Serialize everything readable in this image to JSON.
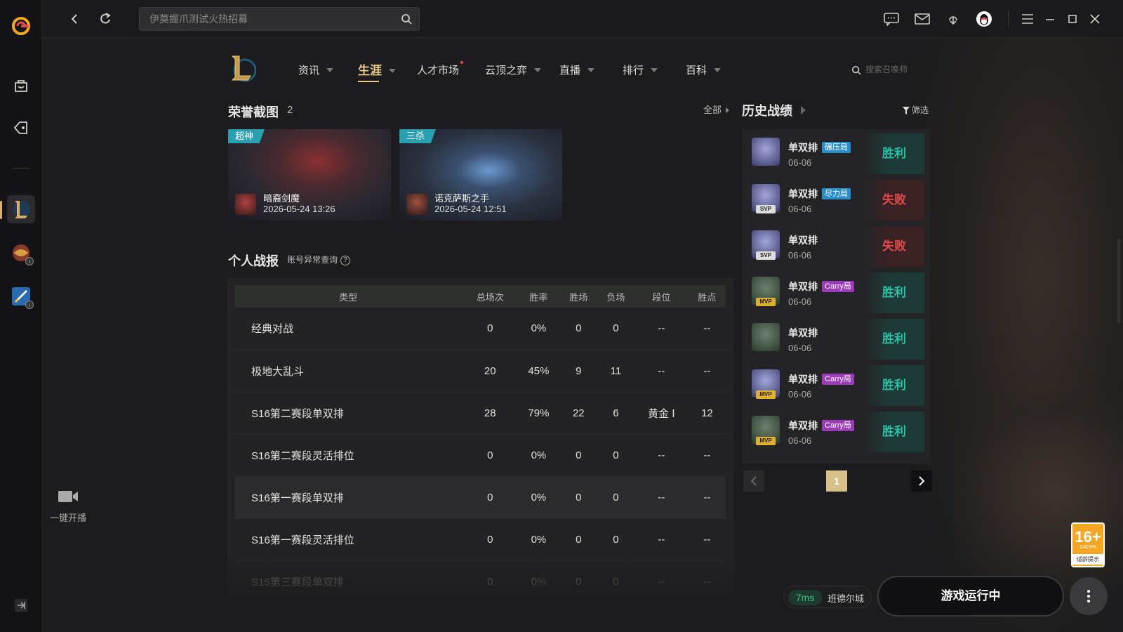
{
  "topbar": {
    "search_placeholder": "伊莫握爪测试火热招募"
  },
  "sidebar": {
    "live_label": "一键开播"
  },
  "nav": {
    "items": [
      {
        "label": "资讯"
      },
      {
        "label": "生涯"
      },
      {
        "label": "人才市场"
      },
      {
        "label": "云顶之弈"
      },
      {
        "label": "直播"
      },
      {
        "label": "排行"
      },
      {
        "label": "百科"
      }
    ],
    "summoner_search": "搜索召唤师"
  },
  "honor": {
    "title": "荣誉截图",
    "count": "2",
    "all_link": "全部",
    "shots": [
      {
        "tag": "超神",
        "champion": "暗裔剑魔",
        "time": "2026-05-24 13:26"
      },
      {
        "tag": "三杀",
        "champion": "诺克萨斯之手",
        "time": "2026-05-24 12:51"
      }
    ]
  },
  "stats": {
    "title": "个人战报",
    "sub_link": "账号异常查询",
    "help": "?",
    "headers": [
      "类型",
      "总场次",
      "胜率",
      "胜场",
      "负场",
      "段位",
      "胜点"
    ],
    "rows": [
      [
        "经典对战",
        "0",
        "0%",
        "0",
        "0",
        "--",
        "--"
      ],
      [
        "极地大乱斗",
        "20",
        "45%",
        "9",
        "11",
        "--",
        "--"
      ],
      [
        "S16第二赛段单双排",
        "28",
        "79%",
        "22",
        "6",
        "黄金 Ⅰ",
        "12"
      ],
      [
        "S16第二赛段灵活排位",
        "0",
        "0%",
        "0",
        "0",
        "--",
        "--"
      ],
      [
        "S16第一赛段单双排",
        "0",
        "0%",
        "0",
        "0",
        "--",
        "--"
      ],
      [
        "S16第一赛段灵活排位",
        "0",
        "0%",
        "0",
        "0",
        "--",
        "--"
      ],
      [
        "S15第三赛段单双排",
        "0",
        "0%",
        "0",
        "0",
        "--",
        "--"
      ]
    ]
  },
  "history": {
    "title": "历史战绩",
    "filter": "筛选",
    "matches": [
      {
        "mode": "单双排",
        "tag": "碾压局",
        "date": "06-06",
        "result": "胜利",
        "badge": ""
      },
      {
        "mode": "单双排",
        "tag": "尽力局",
        "date": "06-06",
        "result": "失败",
        "badge": "SVP"
      },
      {
        "mode": "单双排",
        "tag": "",
        "date": "06-06",
        "result": "失败",
        "badge": "SVP"
      },
      {
        "mode": "单双排",
        "tag": "Carry局",
        "date": "06-06",
        "result": "胜利",
        "badge": "MVP"
      },
      {
        "mode": "单双排",
        "tag": "",
        "date": "06-06",
        "result": "胜利",
        "badge": ""
      },
      {
        "mode": "单双排",
        "tag": "Carry局",
        "date": "06-06",
        "result": "胜利",
        "badge": "MVP"
      },
      {
        "mode": "单双排",
        "tag": "Carry局",
        "date": "06-06",
        "result": "胜利",
        "badge": "MVP"
      }
    ],
    "page": "1"
  },
  "status": {
    "ping": "7ms",
    "server": "班德尔城",
    "play_label": "游戏运行中",
    "age_num": "16+",
    "age_sub": "CADPA",
    "age_text": "适龄提示"
  },
  "colors": {
    "accent_gold": "#e8c887",
    "win": "#2ec0a8",
    "lose": "#e24a4a"
  }
}
